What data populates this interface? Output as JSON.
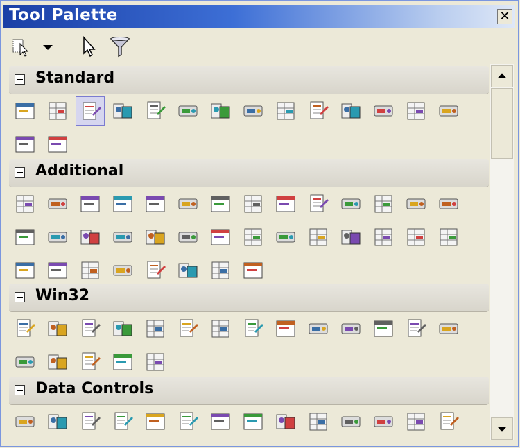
{
  "window": {
    "title": "Tool Palette",
    "close_glyph": "✕"
  },
  "toolbar": {
    "items": [
      {
        "name": "select-component-icon"
      },
      {
        "name": "dropdown-arrow-icon"
      },
      {
        "name": "arrow-pointer-icon"
      },
      {
        "name": "filter-funnel-icon"
      }
    ]
  },
  "sections": [
    {
      "label": "Standard",
      "icons": [
        "form-icon",
        "frame-icon",
        "pointer-select-icon",
        "component-select-icon",
        "label-icon",
        "edit-icon",
        "memo-icon",
        "button-icon",
        "checkbox-icon",
        "radiobutton-icon",
        "listbox-icon",
        "combobox-icon",
        "scrollbar-icon",
        "groupbox-icon",
        "radiogroup-icon",
        "panel-icon"
      ]
    },
    {
      "label": "Additional",
      "icons": [
        "bitbtn-icon",
        "speedbutton-icon",
        "maskedit-icon",
        "stringgrid-icon",
        "drawgrid-icon",
        "image-icon",
        "shape-icon",
        "bevel-icon",
        "scrollbox-icon",
        "checklistbox-icon",
        "splitter-icon",
        "statictext-icon",
        "controlbar-icon",
        "applicationevents-icon",
        "valuelisteditor-icon",
        "labelededit-icon",
        "colorbox-icon",
        "chart-icon",
        "actionmanager-icon",
        "actionmainmenubar-icon",
        "actiontoolbar-icon",
        "customizedlg-icon",
        "xpcolormap-icon",
        "standardcolormap-icon",
        "twilightcolormap-icon",
        "xpmanifest-icon",
        "popupactionbar-icon",
        "colorlistbox-icon",
        "category-buttons-icon",
        "button-group-icon",
        "dock-tab-set-icon",
        "tab-set-icon",
        "grid-panel-icon",
        "pie-chart-icon",
        "flow-panel-icon",
        "tray-icon"
      ]
    },
    {
      "label": "Win32",
      "icons": [
        "tabcontrol-icon",
        "pagecontrol-icon",
        "imagelist-icon",
        "richedit-icon",
        "trackbar-icon",
        "progressbar-icon",
        "updown-icon",
        "hotkey-icon",
        "animate-icon",
        "datetimepicker-icon",
        "monthcalendar-icon",
        "treeview-icon",
        "listview-icon",
        "headercontrol-icon",
        "statusbar-icon",
        "toolbar-icon",
        "coolbar-icon",
        "pagescroller-icon",
        "comboboxex-icon"
      ]
    },
    {
      "label": "Data Controls",
      "icons": [
        "dbgrid-icon",
        "dbnavigator-icon",
        "dbtext-icon",
        "dbedit-icon",
        "dbmemo-icon",
        "dbimage-icon",
        "dblistbox-icon",
        "dbcombobox-icon",
        "dbcheckbox-icon",
        "dbradiogroup-icon",
        "dblookuplistbox-icon",
        "dblookupcombobox-icon",
        "dbrichedit-icon",
        "dbctrlgrid-icon",
        "dbchart-icon"
      ]
    }
  ]
}
